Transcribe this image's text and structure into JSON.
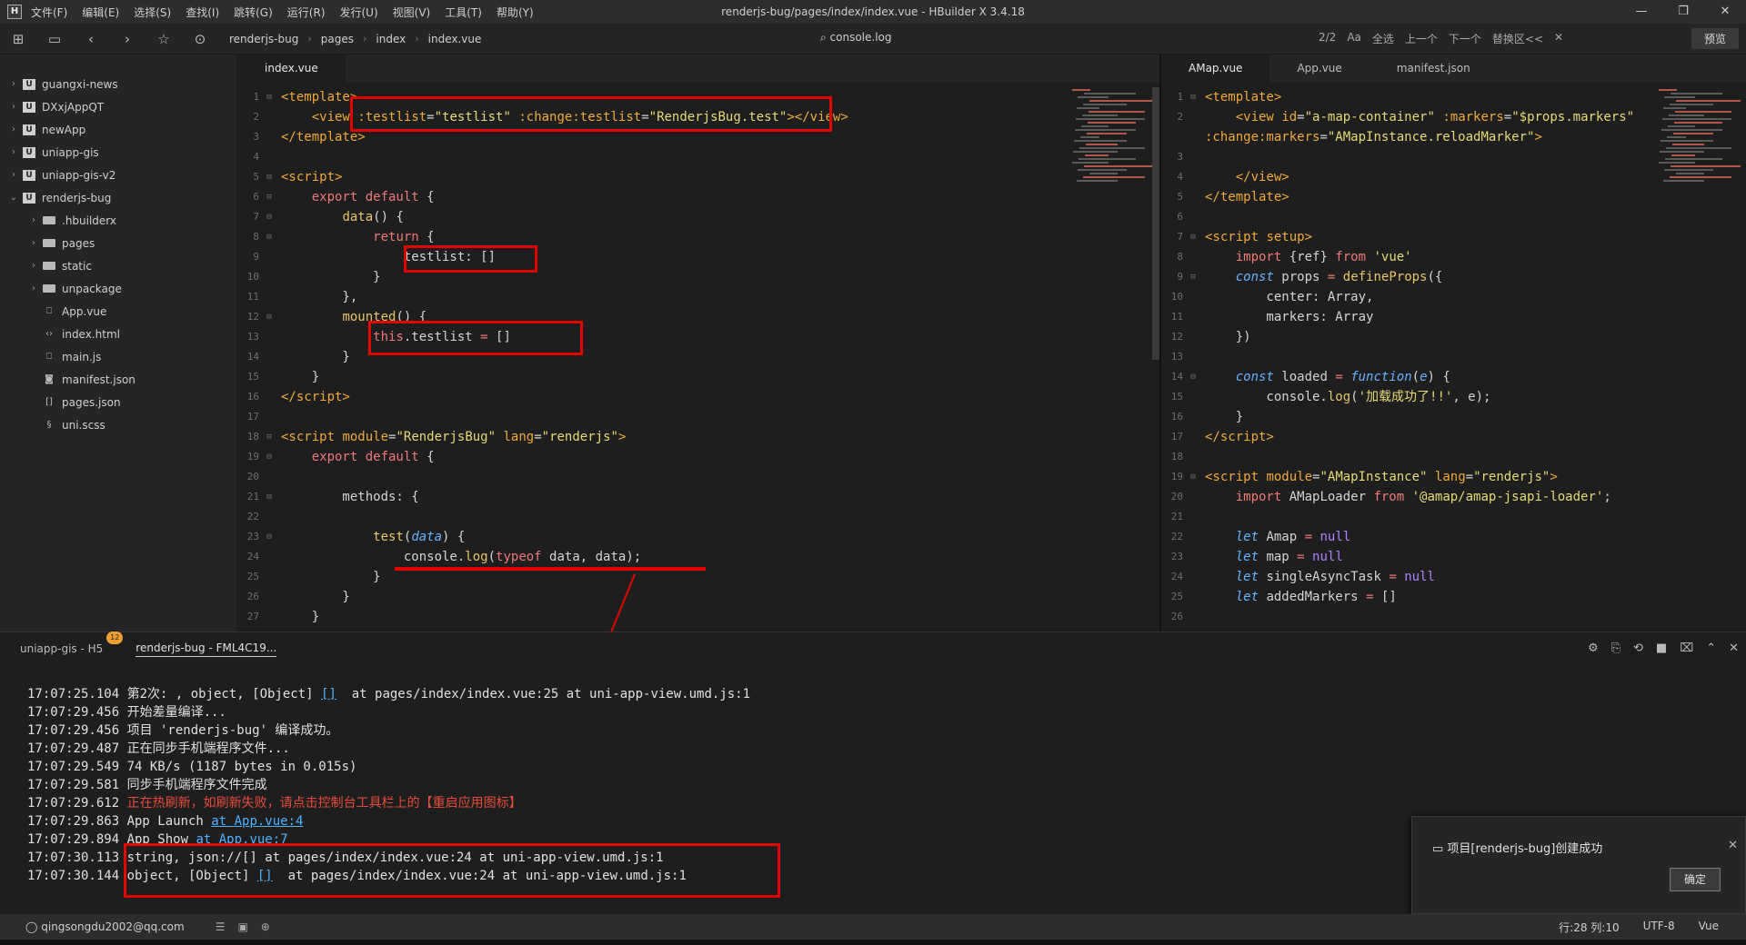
{
  "window": {
    "title": "renderjs-bug/pages/index/index.vue - HBuilder X 3.4.18",
    "logo": "H",
    "menu": [
      "文件(F)",
      "编辑(E)",
      "选择(S)",
      "查找(I)",
      "跳转(G)",
      "运行(R)",
      "发行(U)",
      "视图(V)",
      "工具(T)",
      "帮助(Y)"
    ],
    "controls": [
      "—",
      "❐",
      "✕"
    ]
  },
  "toolbar": {
    "breadcrumbs": [
      "renderjs-bug",
      "pages",
      "index",
      "index.vue"
    ],
    "console_tab": "console.log",
    "find": {
      "count": "2/2",
      "aa": "Aa",
      "select_all": "全选",
      "prev": "上一个",
      "next": "下一个",
      "replace": "替换区<<"
    },
    "preview": "预览"
  },
  "sidebar": {
    "items": [
      {
        "label": "guangxi-news",
        "level": 0,
        "type": "project",
        "expanded": false
      },
      {
        "label": "DXxjAppQT",
        "level": 0,
        "type": "project",
        "expanded": false
      },
      {
        "label": "newApp",
        "level": 0,
        "type": "project",
        "expanded": false
      },
      {
        "label": "uniapp-gis",
        "level": 0,
        "type": "project",
        "expanded": false
      },
      {
        "label": "uniapp-gis-v2",
        "level": 0,
        "type": "project",
        "expanded": false
      },
      {
        "label": "renderjs-bug",
        "level": 0,
        "type": "project",
        "expanded": true
      },
      {
        "label": ".hbuilderx",
        "level": 1,
        "type": "folder",
        "expanded": false
      },
      {
        "label": "pages",
        "level": 1,
        "type": "folder",
        "expanded": false
      },
      {
        "label": "static",
        "level": 1,
        "type": "folder",
        "expanded": false
      },
      {
        "label": "unpackage",
        "level": 1,
        "type": "folder",
        "expanded": false
      },
      {
        "label": "App.vue",
        "level": 1,
        "type": "vue"
      },
      {
        "label": "index.html",
        "level": 1,
        "type": "html"
      },
      {
        "label": "main.js",
        "level": 1,
        "type": "js"
      },
      {
        "label": "manifest.json",
        "level": 1,
        "type": "manifest"
      },
      {
        "label": "pages.json",
        "level": 1,
        "type": "json"
      },
      {
        "label": "uni.scss",
        "level": 1,
        "type": "scss"
      }
    ]
  },
  "editor_left": {
    "tabs": [
      "index.vue"
    ],
    "lines": [
      {
        "n": "1",
        "f": "⊟",
        "h": "<span class='tag'>&lt;template&gt;</span>"
      },
      {
        "n": "2",
        "f": "",
        "h": "    <span class='tag'>&lt;view</span> <span class='attr'>:testlist</span>=<span class='str'>\"testlist\"</span> <span class='attr'>:change:testlist</span>=<span class='str'>\"RenderjsBug.test\"</span><span class='tag'>&gt;&lt;/view&gt;</span>"
      },
      {
        "n": "3",
        "f": "",
        "h": "<span class='tag'>&lt;/template&gt;</span>"
      },
      {
        "n": "4",
        "f": "",
        "h": ""
      },
      {
        "n": "5",
        "f": "⊟",
        "h": "<span class='tag'>&lt;script&gt;</span>"
      },
      {
        "n": "6",
        "f": "⊟",
        "h": "    <span class='kw'>export default</span> {"
      },
      {
        "n": "7",
        "f": "⊟",
        "h": "        <span class='fn'>data</span>() {"
      },
      {
        "n": "8",
        "f": "⊟",
        "h": "            <span class='kw'>return</span> {"
      },
      {
        "n": "9",
        "f": "",
        "h": "                testlist: []"
      },
      {
        "n": "10",
        "f": "",
        "h": "            }"
      },
      {
        "n": "11",
        "f": "",
        "h": "        },"
      },
      {
        "n": "12",
        "f": "⊟",
        "h": "        <span class='fn'>mounted</span>() {"
      },
      {
        "n": "13",
        "f": "",
        "h": "            <span class='kw'>this</span>.testlist <span class='kw'>=</span> []"
      },
      {
        "n": "14",
        "f": "",
        "h": "        }"
      },
      {
        "n": "15",
        "f": "",
        "h": "    }"
      },
      {
        "n": "16",
        "f": "",
        "h": "<span class='tag'>&lt;/script&gt;</span>"
      },
      {
        "n": "17",
        "f": "",
        "h": ""
      },
      {
        "n": "18",
        "f": "⊟",
        "h": "<span class='tag'>&lt;script</span> <span class='attr'>module</span>=<span class='str'>\"RenderjsBug\"</span> <span class='attr'>lang</span>=<span class='str'>\"renderjs\"</span><span class='tag'>&gt;</span>"
      },
      {
        "n": "19",
        "f": "⊟",
        "h": "    <span class='kw'>export default</span> {"
      },
      {
        "n": "20",
        "f": "",
        "h": ""
      },
      {
        "n": "21",
        "f": "⊟",
        "h": "        methods: {"
      },
      {
        "n": "22",
        "f": "",
        "h": ""
      },
      {
        "n": "23",
        "f": "⊟",
        "h": "            <span class='fn'>test</span>(<span class='kwb'>data</span>) {"
      },
      {
        "n": "24",
        "f": "",
        "h": "                console.<span class='fn'>log</span>(<span class='kw'>typeof</span> data, data);"
      },
      {
        "n": "25",
        "f": "",
        "h": "            }"
      },
      {
        "n": "26",
        "f": "",
        "h": "        }"
      },
      {
        "n": "27",
        "f": "",
        "h": "    }"
      }
    ]
  },
  "editor_right": {
    "tabs": [
      "AMap.vue",
      "App.vue",
      "manifest.json"
    ],
    "lines": [
      {
        "n": "1",
        "f": "⊟",
        "h": "<span class='tag'>&lt;template&gt;</span>"
      },
      {
        "n": "2",
        "f": "",
        "h": "    <span class='tag'>&lt;view</span> <span class='attr'>id</span>=<span class='str'>\"a-map-container\"</span> <span class='attr'>:markers</span>=<span class='str'>\"$props.markers\"</span>"
      },
      {
        "n": "",
        "f": "",
        "h": "<span class='attr'>:change:markers</span>=<span class='str'>\"AMapInstance.reloadMarker\"</span><span class='tag'>&gt;</span>"
      },
      {
        "n": "3",
        "f": "",
        "h": ""
      },
      {
        "n": "4",
        "f": "",
        "h": "    <span class='tag'>&lt;/view&gt;</span>"
      },
      {
        "n": "5",
        "f": "",
        "h": "<span class='tag'>&lt;/template&gt;</span>"
      },
      {
        "n": "6",
        "f": "",
        "h": ""
      },
      {
        "n": "7",
        "f": "⊟",
        "h": "<span class='tag'>&lt;script</span> <span class='attr'>setup</span><span class='tag'>&gt;</span>"
      },
      {
        "n": "8",
        "f": "",
        "h": "    <span class='kw'>import</span> {ref} <span class='kw'>from</span> <span class='str'>'vue'</span>"
      },
      {
        "n": "9",
        "f": "⊟",
        "h": "    <span class='kwb'>const</span> props <span class='kw'>=</span> <span class='fn'>defineProps</span>({"
      },
      {
        "n": "10",
        "f": "",
        "h": "        center: Array,"
      },
      {
        "n": "11",
        "f": "",
        "h": "        markers: Array"
      },
      {
        "n": "12",
        "f": "",
        "h": "    })"
      },
      {
        "n": "13",
        "f": "",
        "h": ""
      },
      {
        "n": "14",
        "f": "⊟",
        "h": "    <span class='kwb'>const</span> loaded <span class='kw'>=</span> <span class='kwb'>function</span>(<span class='kwb'>e</span>) {"
      },
      {
        "n": "15",
        "f": "",
        "h": "        console.<span class='fn'>log</span>(<span class='str'>'加载成功了!!'</span>, e);"
      },
      {
        "n": "16",
        "f": "",
        "h": "    }"
      },
      {
        "n": "17",
        "f": "",
        "h": "<span class='tag'>&lt;/script&gt;</span>"
      },
      {
        "n": "18",
        "f": "",
        "h": ""
      },
      {
        "n": "19",
        "f": "⊟",
        "h": "<span class='tag'>&lt;script</span> <span class='attr'>module</span>=<span class='str'>\"AMapInstance\"</span> <span class='attr'>lang</span>=<span class='str'>\"renderjs\"</span><span class='tag'>&gt;</span>"
      },
      {
        "n": "20",
        "f": "",
        "h": "    <span class='kw'>import</span> AMapLoader <span class='kw'>from</span> <span class='str'>'@amap/amap-jsapi-loader'</span>;"
      },
      {
        "n": "21",
        "f": "",
        "h": ""
      },
      {
        "n": "22",
        "f": "",
        "h": "    <span class='kwb'>let</span> Amap <span class='kw'>=</span> <span class='num'>null</span>"
      },
      {
        "n": "23",
        "f": "",
        "h": "    <span class='kwb'>let</span> map <span class='kw'>=</span> <span class='num'>null</span>"
      },
      {
        "n": "24",
        "f": "",
        "h": "    <span class='kwb'>let</span> singleAsyncTask <span class='kw'>=</span> <span class='num'>null</span>"
      },
      {
        "n": "25",
        "f": "",
        "h": "    <span class='kwb'>let</span> addedMarkers <span class='kw'>=</span> []"
      },
      {
        "n": "26",
        "f": "",
        "h": ""
      }
    ]
  },
  "console": {
    "tabs": [
      {
        "label": "uniapp-gis - H5",
        "badge": "12",
        "active": false
      },
      {
        "label": "renderjs-bug - FML4C19...",
        "active": true
      }
    ],
    "lines": [
      {
        "h": "17:07:25.104 第2次: , object, [Object] <span class='link'>[]</span>  at pages/index/index.vue:25 at uni-app-view.umd.js:1"
      },
      {
        "h": "17:07:29.456 开始差量编译..."
      },
      {
        "h": "17:07:29.456 项目 'renderjs-bug' 编译成功。"
      },
      {
        "h": "17:07:29.487 正在同步手机端程序文件..."
      },
      {
        "h": "17:07:29.549 74 KB/s (1187 bytes in 0.015s)"
      },
      {
        "h": "17:07:29.581 同步手机端程序文件完成"
      },
      {
        "h": "17:07:29.612 <span class='warn'>正在热刷新，如刷新失败，请点击控制台工具栏上的【重启应用图标】</span>"
      },
      {
        "h": "17:07:29.863 App Launch <span class='link'>at App.vue:4</span>"
      },
      {
        "h": "17:07:29.894 App Show <span class='link'>at App.vue:7</span>"
      },
      {
        "h": "17:07:30.113 string, json://[] at pages/index/index.vue:24 at uni-app-view.umd.js:1"
      },
      {
        "h": "17:07:30.144 object, [Object] <span class='link'>[]</span>  at pages/index/index.vue:24 at uni-app-view.umd.js:1"
      }
    ]
  },
  "toast": {
    "message": "项目[renderjs-bug]创建成功",
    "ok": "确定",
    "close": "✕"
  },
  "statusbar": {
    "user": "qingsongdu2002@qq.com",
    "position": "行:28  列:10",
    "encoding": "UTF-8",
    "language": "Vue"
  },
  "colors": {
    "annotation": "#e30000",
    "background": "#1e1e1e"
  }
}
